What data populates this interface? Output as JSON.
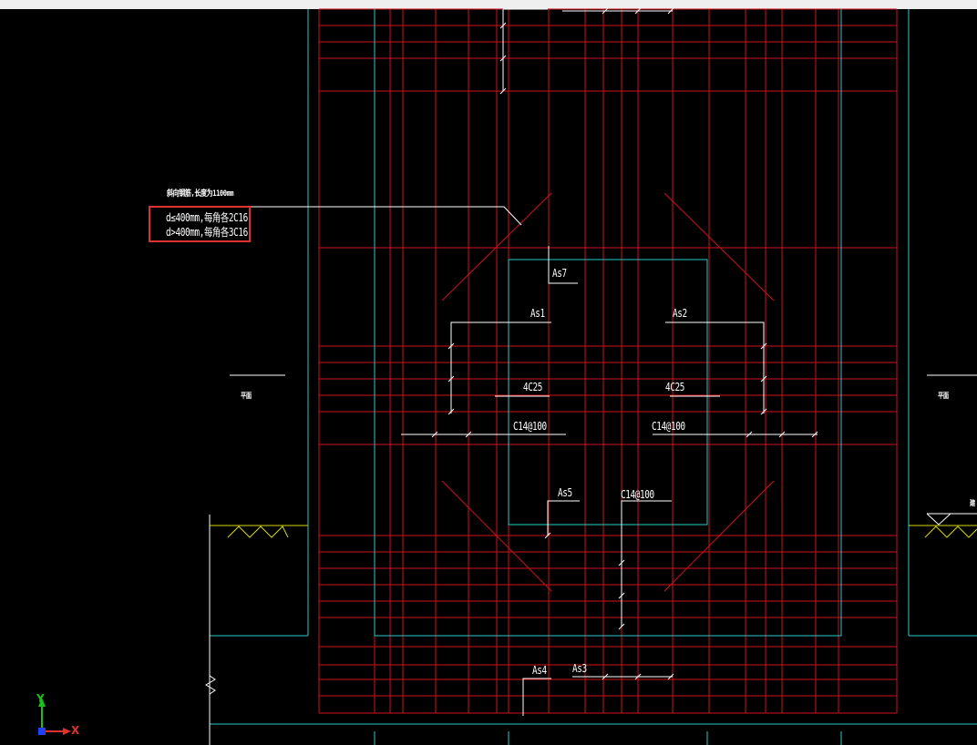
{
  "colors": {
    "background": "#000000",
    "rebar": "#d0101e",
    "outline": "#2ec8c8",
    "leader": "#ffffff",
    "highlight": "#e03030",
    "ground": "#d8d800",
    "axis_x": "#e03030",
    "axis_y": "#18c018"
  },
  "annotations": {
    "note_title": "斜向钢筋,长度为1100mm",
    "note_line1": "d≤400mm,每角各2C16",
    "note_line2": "d>400mm,每角各3C16",
    "as7": "As7",
    "as1": "As1",
    "as2": "As2",
    "rebar_left": "4C25",
    "rebar_right": "4C25",
    "stirrup_left": "C14@100",
    "stirrup_right": "C14@100",
    "as5": "As5",
    "stirrup_bottom": "C14@100",
    "as4": "As4",
    "as3": "As3",
    "side_left": "平面",
    "side_right": "平面",
    "far_right_mark": "建"
  },
  "ucs": {
    "x_label": "X",
    "y_label": "Y"
  },
  "icons": [
    "ucs-axis-icon",
    "break-line-icon",
    "ground-hatch-icon"
  ]
}
